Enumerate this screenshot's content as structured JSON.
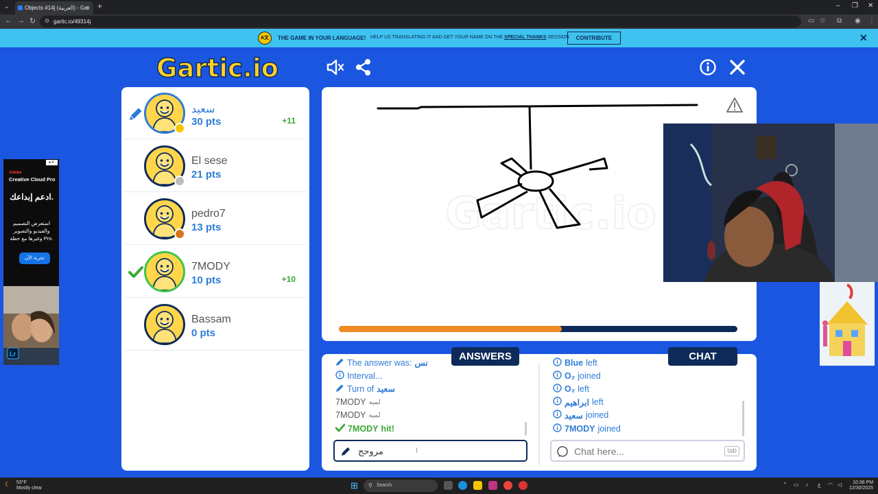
{
  "browser": {
    "tab_title": "Objects #14j (العربية) - Gar",
    "url": "gartic.io/49314j"
  },
  "banner": {
    "headline": "THE GAME IN YOUR LANGUAGE!",
    "text_before": "HELP US TRANSLATING IT AND GET YOUR NAME ON THE",
    "text_link": "SPECIAL THANKS",
    "text_after": "SESSION",
    "contribute_label": "CONTRIBUTE"
  },
  "logo": {
    "text": "Gartic.io"
  },
  "players": [
    {
      "name": "سعيد",
      "points": "30 pts",
      "gain": "+11",
      "status": "drawing",
      "dot_color": "#f7c600",
      "is_me": true
    },
    {
      "name": "El sese",
      "points": "21 pts",
      "gain": "",
      "status": "",
      "dot_color": "#bdbdbd",
      "is_me": false
    },
    {
      "name": "pedro7",
      "points": "13 pts",
      "gain": "",
      "status": "",
      "dot_color": "#d9741a",
      "is_me": false
    },
    {
      "name": "7MODY",
      "points": "10 pts",
      "gain": "+10",
      "status": "hit",
      "dot_color": "",
      "is_me": false
    },
    {
      "name": "Bassam",
      "points": "0 pts",
      "gain": "",
      "status": "",
      "dot_color": "",
      "is_me": false
    }
  ],
  "timer_progress": 0.56,
  "answers": {
    "tab_label": "ANSWERS",
    "lines": [
      {
        "type": "info",
        "prefix": "The answer was:",
        "value": "نس"
      },
      {
        "type": "info",
        "prefix": "Interval...",
        "value": ""
      },
      {
        "type": "turn",
        "prefix": "Turn of",
        "value": "سعيد"
      },
      {
        "type": "guess",
        "prefix": "7MODY",
        "value": "لمبه"
      },
      {
        "type": "guess",
        "prefix": "7MODY",
        "value": "لمبه"
      },
      {
        "type": "hit",
        "prefix": "7MODY",
        "value": "hit!"
      }
    ],
    "input_value": "مروحج"
  },
  "chat": {
    "tab_label": "CHAT",
    "lines": [
      {
        "name": "Blue",
        "action": "left"
      },
      {
        "name": "O₂",
        "action": "joined"
      },
      {
        "name": "O₂",
        "action": "left"
      },
      {
        "name": "ابراهيم",
        "action": "left"
      },
      {
        "name": "سعيد",
        "action": "joined"
      },
      {
        "name": "7MODY",
        "action": "joined"
      }
    ],
    "input_placeholder": "Chat here...",
    "tab_key": "tab"
  },
  "ad_left": {
    "brand": "Adobe",
    "product": "Creative Cloud Pro",
    "headline": "ادعم إبداعك.",
    "body": "استعرض التصميم والفيديو والتصوير وغيرها مع خطة Pro.",
    "cta": "تجربة الآن"
  },
  "taskbar": {
    "weather_temp": "53°F",
    "weather_text": "Mostly clear",
    "search_label": "Search",
    "time": "10:38 PM",
    "date": "12/30/2025"
  }
}
